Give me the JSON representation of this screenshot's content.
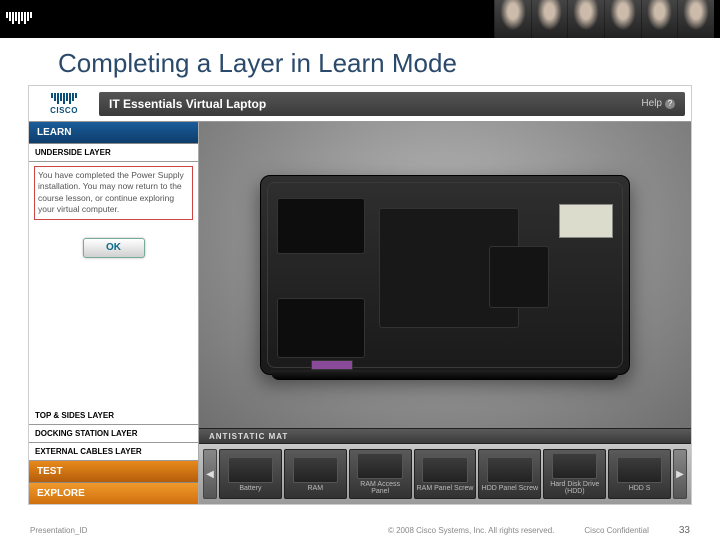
{
  "header": {
    "brand": "cisco"
  },
  "slide": {
    "title": "Completing a Layer in Learn Mode"
  },
  "app": {
    "brand": "CISCO",
    "title": "IT Essentials Virtual Laptop",
    "help": "Help"
  },
  "sidebar": {
    "modes": {
      "learn": "LEARN",
      "test": "TEST",
      "explore": "EXPLORE"
    },
    "current_layer": "UNDERSIDE LAYER",
    "message": "You have completed the Power Supply installation. You may now return to the course lesson, or continue exploring your virtual computer.",
    "ok_label": "OK",
    "layers": [
      "TOP & SIDES LAYER",
      "DOCKING STATION LAYER",
      "EXTERNAL CABLES LAYER"
    ]
  },
  "main": {
    "mat_label": "ANTISTATIC MAT",
    "tray": [
      {
        "label": "Battery"
      },
      {
        "label": "RAM"
      },
      {
        "label": "RAM Access Panel"
      },
      {
        "label": "RAM Panel Screw"
      },
      {
        "label": "HDD Panel Screw"
      },
      {
        "label": "Hard Disk Drive (HDD)"
      },
      {
        "label": "HDD S"
      }
    ],
    "nav": {
      "prev": "◀",
      "next": "▶"
    }
  },
  "footer": {
    "left": "Presentation_ID",
    "center": "© 2008 Cisco Systems, Inc. All rights reserved.",
    "right": "Cisco Confidential",
    "page": "33"
  }
}
